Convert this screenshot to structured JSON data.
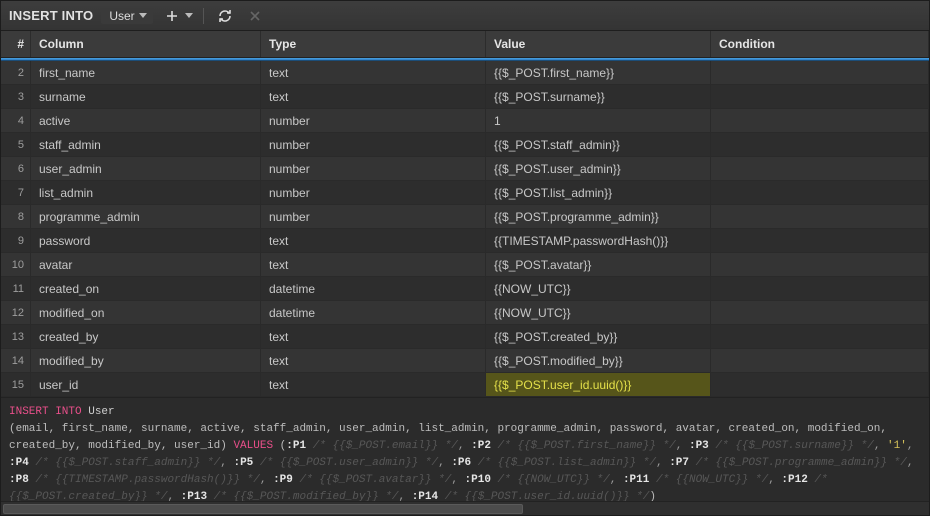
{
  "toolbar": {
    "insert_kw": "INSERT INTO",
    "table": "User"
  },
  "headers": {
    "idx": "#",
    "column": "Column",
    "type": "Type",
    "value": "Value",
    "condition": "Condition"
  },
  "rows": [
    {
      "n": "2",
      "column": "first_name",
      "type": "text",
      "value": "{{$_POST.first_name}}",
      "highlight": false
    },
    {
      "n": "3",
      "column": "surname",
      "type": "text",
      "value": "{{$_POST.surname}}",
      "highlight": false
    },
    {
      "n": "4",
      "column": "active",
      "type": "number",
      "value": "1",
      "highlight": false
    },
    {
      "n": "5",
      "column": "staff_admin",
      "type": "number",
      "value": "{{$_POST.staff_admin}}",
      "highlight": false
    },
    {
      "n": "6",
      "column": "user_admin",
      "type": "number",
      "value": "{{$_POST.user_admin}}",
      "highlight": false
    },
    {
      "n": "7",
      "column": "list_admin",
      "type": "number",
      "value": "{{$_POST.list_admin}}",
      "highlight": false
    },
    {
      "n": "8",
      "column": "programme_admin",
      "type": "number",
      "value": "{{$_POST.programme_admin}}",
      "highlight": false
    },
    {
      "n": "9",
      "column": "password",
      "type": "text",
      "value": "{{TIMESTAMP.passwordHash()}}",
      "highlight": false
    },
    {
      "n": "10",
      "column": "avatar",
      "type": "text",
      "value": "{{$_POST.avatar}}",
      "highlight": false
    },
    {
      "n": "11",
      "column": "created_on",
      "type": "datetime",
      "value": "{{NOW_UTC}}",
      "highlight": false
    },
    {
      "n": "12",
      "column": "modified_on",
      "type": "datetime",
      "value": "{{NOW_UTC}}",
      "highlight": false
    },
    {
      "n": "13",
      "column": "created_by",
      "type": "text",
      "value": "{{$_POST.created_by}}",
      "highlight": false
    },
    {
      "n": "14",
      "column": "modified_by",
      "type": "text",
      "value": "{{$_POST.modified_by}}",
      "highlight": false
    },
    {
      "n": "15",
      "column": "user_id",
      "type": "text",
      "value": "{{$_POST.user_id.uuid()}}",
      "highlight": true
    }
  ],
  "sql": {
    "kw_insert": "INSERT INTO",
    "table": "User",
    "cols": "(email, first_name, surname, active, staff_admin, user_admin, list_admin, programme_admin, password, avatar, created_on, modified_on, created_by, modified_by, user_id)",
    "kw_values": "VALUES",
    "params": [
      {
        "p": ":P1",
        "c": "/* {{$_POST.email}} */"
      },
      {
        "p": ":P2",
        "c": "/* {{$_POST.first_name}} */"
      },
      {
        "p": ":P3",
        "c": "/* {{$_POST.surname}} */"
      },
      {
        "p": "'1'",
        "c": "",
        "lit": true
      },
      {
        "p": ":P4",
        "c": "/* {{$_POST.staff_admin}} */"
      },
      {
        "p": ":P5",
        "c": "/* {{$_POST.user_admin}} */"
      },
      {
        "p": ":P6",
        "c": "/* {{$_POST.list_admin}} */"
      },
      {
        "p": ":P7",
        "c": "/* {{$_POST.programme_admin}} */"
      },
      {
        "p": ":P8",
        "c": "/* {{TIMESTAMP.passwordHash()}} */"
      },
      {
        "p": ":P9",
        "c": "/* {{$_POST.avatar}} */"
      },
      {
        "p": ":P10",
        "c": "/* {{NOW_UTC}} */"
      },
      {
        "p": ":P11",
        "c": "/* {{NOW_UTC}} */"
      },
      {
        "p": ":P12",
        "c": "/* {{$_POST.created_by}} */"
      },
      {
        "p": ":P13",
        "c": "/* {{$_POST.modified_by}} */"
      },
      {
        "p": ":P14",
        "c": "/* {{$_POST.user_id.uuid()}} */"
      }
    ]
  }
}
